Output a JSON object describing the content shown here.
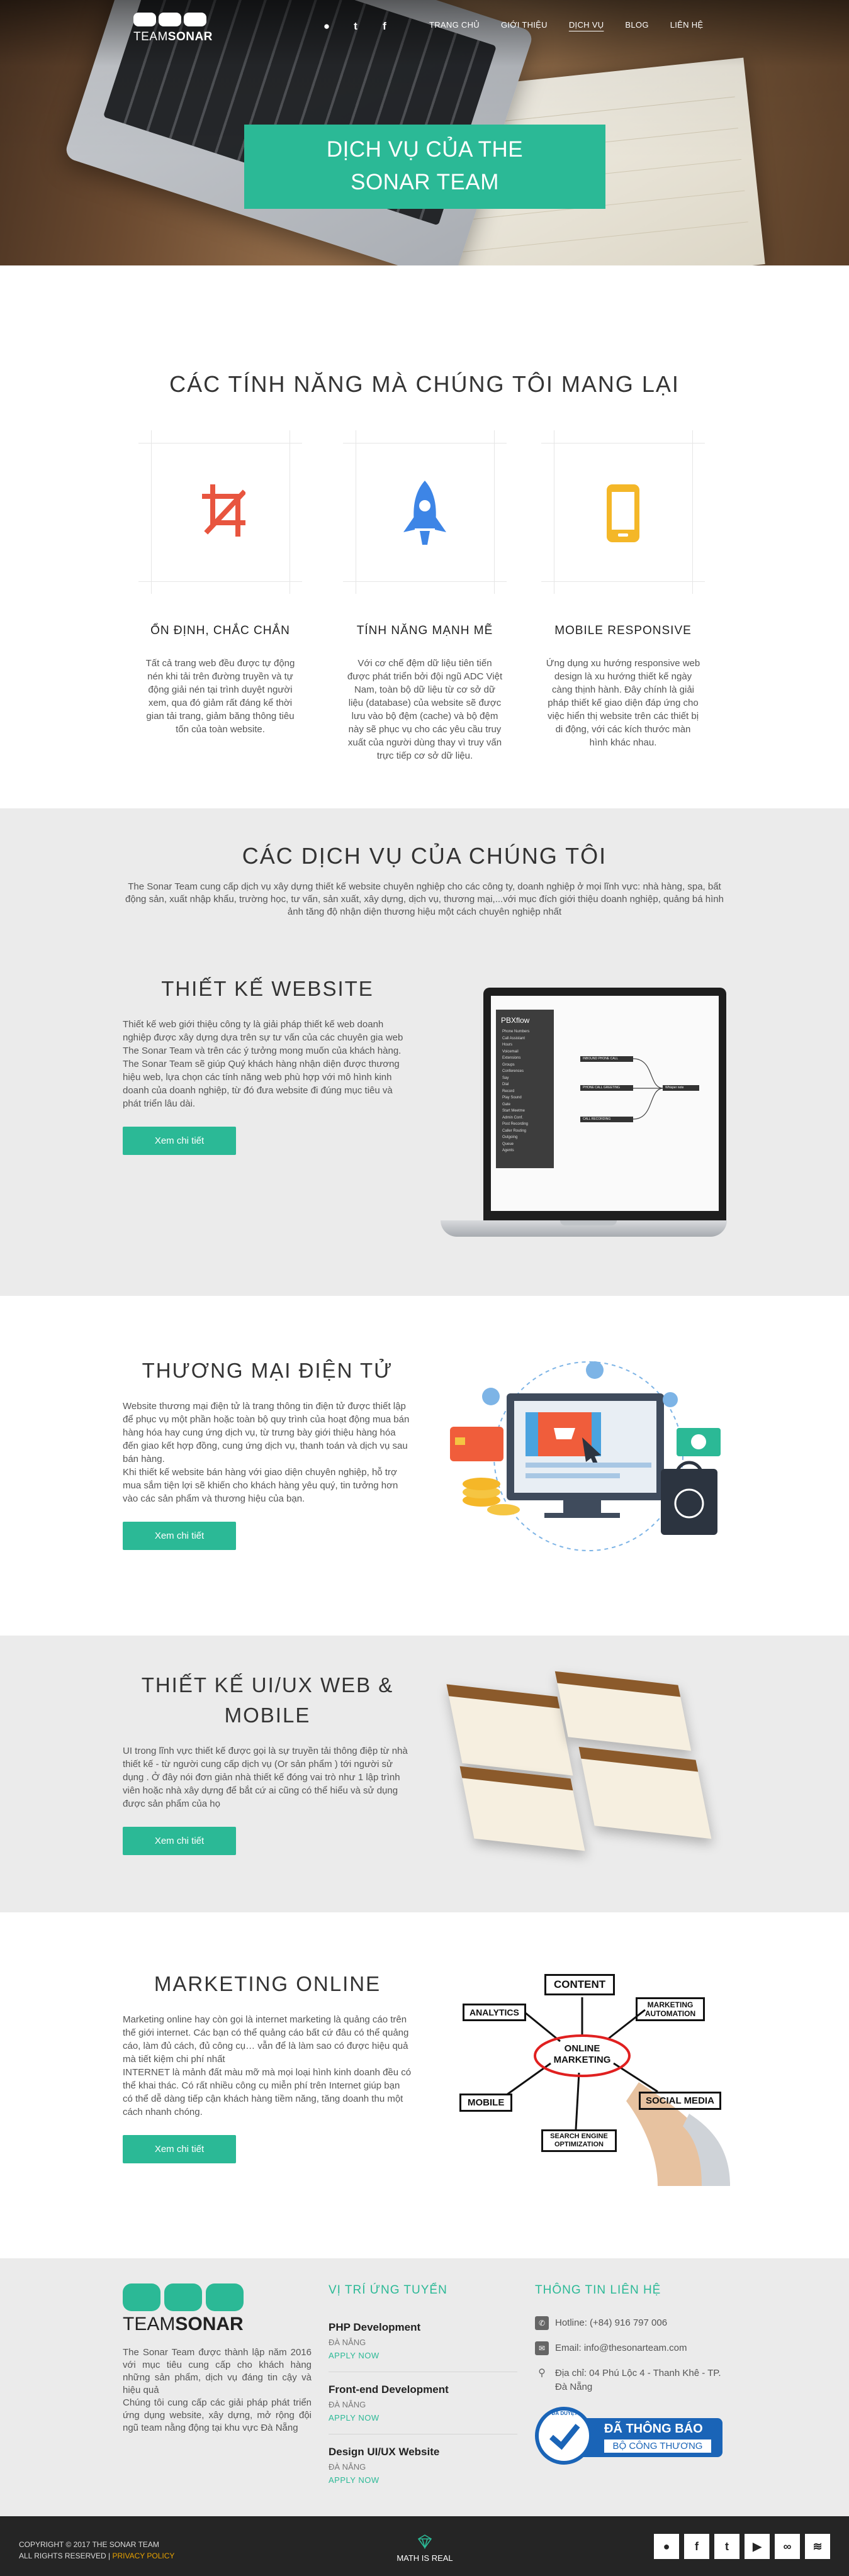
{
  "brand": {
    "team": "TEAM",
    "sonar": "SONAR"
  },
  "nav": {
    "social": [
      "github-icon",
      "twitter-icon",
      "facebook-icon"
    ],
    "social_glyphs": [
      "●",
      "t",
      "f"
    ],
    "items": [
      "TRANG CHỦ",
      "GIỚI THIỆU",
      "DỊCH VỤ",
      "BLOG",
      "LIÊN HỆ"
    ],
    "active": "DỊCH VỤ"
  },
  "hero": {
    "title_line1": "DỊCH VỤ CỦA THE",
    "title_line2": "SONAR TEAM"
  },
  "features": {
    "title": "CÁC TÍNH NĂNG MÀ CHÚNG TÔI MANG LẠI",
    "items": [
      {
        "icon": "crop-icon",
        "heading": "ỔN ĐỊNH, CHẮC CHẮN",
        "text": "Tất cả trang web đều được tự động nén khi tải trên đường truyền và tự động giải nén tại trình duyệt người xem, qua đó giảm rất đáng kể thời gian tải trang, giảm băng thông tiêu tốn của toàn website.",
        "color": "#e8553f"
      },
      {
        "icon": "rocket-icon",
        "heading": "TÍNH NĂNG MẠNH MẼ",
        "text": "Với cơ chế đệm dữ liệu tiên tiến được phát triển bởi đội ngũ ADC Việt Nam, toàn bộ dữ liệu từ cơ sở dữ liệu (database) của website sẽ được lưu vào bộ đệm (cache) và bộ đệm này sẽ phục vụ cho các yêu cầu truy xuất của người dùng thay vì truy vấn trực tiếp cơ sở dữ liệu.",
        "color": "#3d85e6"
      },
      {
        "icon": "mobile-icon",
        "heading": "MOBILE RESPONSIVE",
        "text": "Ứng dụng xu hướng responsive web design là xu hướng thiết kế ngày càng thịnh hành. Đây chính là giải pháp thiết kế giao diện đáp ứng cho việc hiển thị website trên các thiết bị di động, với các kích thước màn hình khác nhau.",
        "color": "#f4b728"
      }
    ]
  },
  "services": {
    "title": "CÁC DỊCH VỤ CỦA CHÚNG TÔI",
    "intro": "The Sonar Team cung cấp dịch vụ xây dựng thiết kế website chuyên nghiệp cho các công ty, doanh nghiệp ở mọi lĩnh vực: nhà hàng, spa, bất động sản, xuất nhập khẩu, trường học, tư vấn, sản xuất, xây dựng, dịch vụ, thương mại,...với mục đích giới thiệu doanh nghiệp, quảng bá hình ảnh tăng độ nhận diện thương hiệu một cách chuyên nghiệp nhất",
    "button": "Xem chi tiết",
    "blocks": [
      {
        "title": "THIẾT KẾ WEBSITE",
        "text": "Thiết kế web giới thiệu công ty là giải pháp thiết kế web doanh nghiệp được xây dựng dựa trên sự tư vấn của các chuyên gia web The Sonar Team và trên các ý tưởng mong muốn của khách hàng. The Sonar Team sẽ giúp Quý khách hàng nhận diện được thương hiệu web, lựa chọn các tính năng web phù hợp với mô hình kinh doanh của doanh nghiệp, từ đó đưa website đi đúng mục tiêu và phát triển lâu dài."
      },
      {
        "title": "THƯƠNG MẠI ĐIỆN TỬ",
        "text": "Website thương mại điện tử là trang thông tin điện tử được thiết lập để phục vụ một phần hoặc toàn bộ quy trình của hoạt động mua bán hàng hóa hay cung ứng dịch vụ, từ trưng bày giới thiệu hàng hóa đến giao kết hợp đồng, cung ứng dịch vụ, thanh toán và dịch vụ sau bán hàng.\nKhi thiết kế website bán hàng với giao diện chuyên nghiệp, hỗ trợ mua sắm tiện lợi sẽ khiến cho khách hàng yêu quý, tin tưởng hơn vào các sản phẩm và thương hiệu của bạn."
      },
      {
        "title": "THIẾT KẾ UI/UX WEB & MOBILE",
        "text": "UI trong lĩnh vực thiết kế được gọi là sự truyền tải thông điệp từ nhà thiết kế - từ người cung cấp dịch vụ (Or sản phẩm ) tới người sử dụng . Ở đây nói đơn giản nhà thiết kế đóng vai trò như 1 lập trình viên hoặc nhà xây dựng để bắt cứ ai cũng có thể hiểu và sử dụng được sản phẩm của họ"
      },
      {
        "title": "MARKETING ONLINE",
        "text": "Marketing online hay còn gọi là internet marketing là quảng cáo trên thế giới internet. Các bạn có thể quảng cáo bất cứ đâu có thể quảng cáo, làm đủ cách, đủ công cụ… vẫn để là làm sao có được hiệu quả mà tiết kiệm chi phí nhất\nINTERNET là mảnh đất màu mỡ mà mọi loại hình kinh doanh đều có thể khai thác. Có rất nhiều công cụ miễn phí trên Internet giúp bạn có thể dễ dàng tiếp cận khách hàng tiềm năng, tăng doanh thu một cách nhanh chóng."
      }
    ]
  },
  "screen_mock": {
    "app": "PBXflow",
    "menu": [
      "Phone Numbers",
      "Call Assistant",
      "Hours",
      "Voicemail",
      "Extensions",
      "Groups",
      "Conferences",
      "Say",
      "Dial",
      "Record",
      "Play Sound",
      "Gate",
      "Start Meetme",
      "Admin Conf.",
      "Post Recording",
      "Caller Routing",
      "Outgoing",
      "Queue",
      "Agents"
    ],
    "nodes": [
      "INBOUND PHONE CALL",
      "PHONE CALL GREETING",
      "CALL RECORDING",
      "Whisper note"
    ]
  },
  "marketing_words": [
    "CONTENT",
    "ANALYTICS",
    "MARKETING AUTOMATION",
    "ONLINE MARKETING",
    "MOBILE",
    "SOCIAL MEDIA",
    "SEARCH ENGINE OPTIMIZATION"
  ],
  "footer": {
    "about": "The Sonar Team được thành lập năm 2016 với mục tiêu cung cấp cho khách hàng những sản phẩm, dịch vụ đáng tin cậy và hiệu quả\nChúng tôi cung cấp các giải pháp phát triển ứng dụng website, xây dựng, mở rộng đội ngũ team nằng động tại khu vực Đà Nẵng",
    "jobs_title": "VỊ TRÍ ỨNG TUYỂN",
    "jobs": [
      {
        "title": "PHP Development",
        "loc": "ĐÀ NẴNG",
        "apply": "APPLY NOW"
      },
      {
        "title": "Front-end Development",
        "loc": "ĐÀ NẴNG",
        "apply": "APPLY NOW"
      },
      {
        "title": "Design UI/UX Website",
        "loc": "ĐÀ NẴNG",
        "apply": "APPLY NOW"
      }
    ],
    "contact_title": "THÔNG TIN LIÊN HỆ",
    "hotline": "Hotline: (+84) 916 797 006",
    "email": "Email: info@thesonarteam.com",
    "address": "Địa chỉ: 04 Phú Lộc 4 - Thanh Khê - TP. Đà Nẵng",
    "badge_line1": "ĐÃ THÔNG BÁO",
    "badge_line2": "BỘ CÔNG THƯƠNG",
    "badge_seal": "ĐÃ DUYỆT"
  },
  "bottom": {
    "copyright": "COPYRIGHT © 2017 THE SONAR TEAM",
    "rights": "ALL RIGHTS RESERVED |",
    "privacy": "PRIVACY POLICY",
    "tagline": "MATH IS REAL",
    "social": [
      "github-icon",
      "facebook-icon",
      "twitter-icon",
      "youtube-icon",
      "link-icon",
      "rss-icon"
    ],
    "social_glyphs": [
      "●",
      "f",
      "t",
      "▶",
      "∞",
      "≋"
    ]
  }
}
